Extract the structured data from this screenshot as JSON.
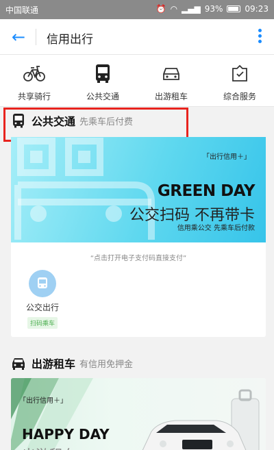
{
  "status_bar": {
    "carrier": "中国联通",
    "battery": "93%",
    "time": "09:23"
  },
  "header": {
    "title": "信用出行"
  },
  "categories": [
    {
      "label": "共享骑行",
      "icon": "bicycle-icon"
    },
    {
      "label": "公共交通",
      "icon": "bus-icon"
    },
    {
      "label": "出游租车",
      "icon": "car-icon"
    },
    {
      "label": "综合服务",
      "icon": "service-icon"
    }
  ],
  "section1": {
    "title": "公共交通",
    "subtitle": "先乘车后付费"
  },
  "banner1": {
    "tag": "出行信用＋",
    "title": "GREEN DAY",
    "subtitle": "公交扫码  不再带卡",
    "note": "信用乘公交 先乘车后付款"
  },
  "pay_hint": "“点击打开电子支付码直接支付”",
  "service": {
    "label": "公交出行",
    "badge": "扫码乘车"
  },
  "section2": {
    "title": "出游租车",
    "subtitle": "有信用免押金"
  },
  "banner2": {
    "tag": "出行信用＋",
    "title": "HAPPY DAY",
    "subtitle": "出游租车"
  },
  "colors": {
    "accent": "#1a8cff",
    "highlight": "#e8231e",
    "banner_blue": "#5fd8ef",
    "badge_green": "#4caf50"
  }
}
